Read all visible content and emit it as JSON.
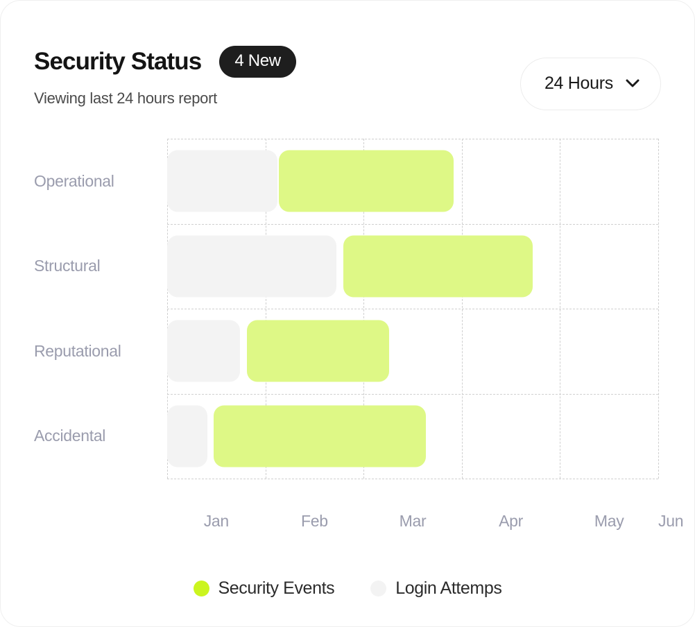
{
  "header": {
    "title": "Security Status",
    "badge": "4 New",
    "subtitle": "Viewing last 24 hours report"
  },
  "range_select": {
    "value": "24 Hours",
    "icon": "chevron-down-icon"
  },
  "legend": [
    {
      "label": "Security Events",
      "color": "#cbf51f",
      "icon": "legend-dot-icon"
    },
    {
      "label": "Login Attemps",
      "color": "#f3f3f3",
      "icon": "legend-dot-icon"
    }
  ],
  "colors": {
    "security_events_bar": "#def886",
    "security_events_dot": "#cbf51f",
    "login_attempts_bar": "#f3f3f3",
    "badge_bg": "#1e1e1e",
    "grid_line": "#cfcfcf",
    "axis_label": "#9a9cad",
    "card_bg": "#ffffff"
  },
  "chart_data": {
    "type": "bar",
    "orientation": "horizontal",
    "title": "Security Status",
    "xlabel": "",
    "ylabel": "",
    "grid": true,
    "legend_position": "bottom",
    "categories": [
      "Operational",
      "Structural",
      "Reputational",
      "Accidental"
    ],
    "x": [
      "Jan",
      "Feb",
      "Mar",
      "Apr",
      "May",
      "Jun"
    ],
    "xlim": [
      0,
      6
    ],
    "series": [
      {
        "name": "Login Attemps",
        "color": "#f3f3f3",
        "ranges": [
          {
            "category": "Operational",
            "start": 0.0,
            "end": 1.35
          },
          {
            "category": "Structural",
            "start": 0.0,
            "end": 2.07
          },
          {
            "category": "Reputational",
            "start": 0.0,
            "end": 0.89
          },
          {
            "category": "Accidental",
            "start": 0.0,
            "end": 0.49
          }
        ]
      },
      {
        "name": "Security Events",
        "color": "#def886",
        "ranges": [
          {
            "category": "Operational",
            "start": 1.36,
            "end": 3.5
          },
          {
            "category": "Structural",
            "start": 2.15,
            "end": 4.47
          },
          {
            "category": "Reputational",
            "start": 0.97,
            "end": 2.71
          },
          {
            "category": "Accidental",
            "start": 0.57,
            "end": 3.16
          }
        ]
      }
    ]
  }
}
